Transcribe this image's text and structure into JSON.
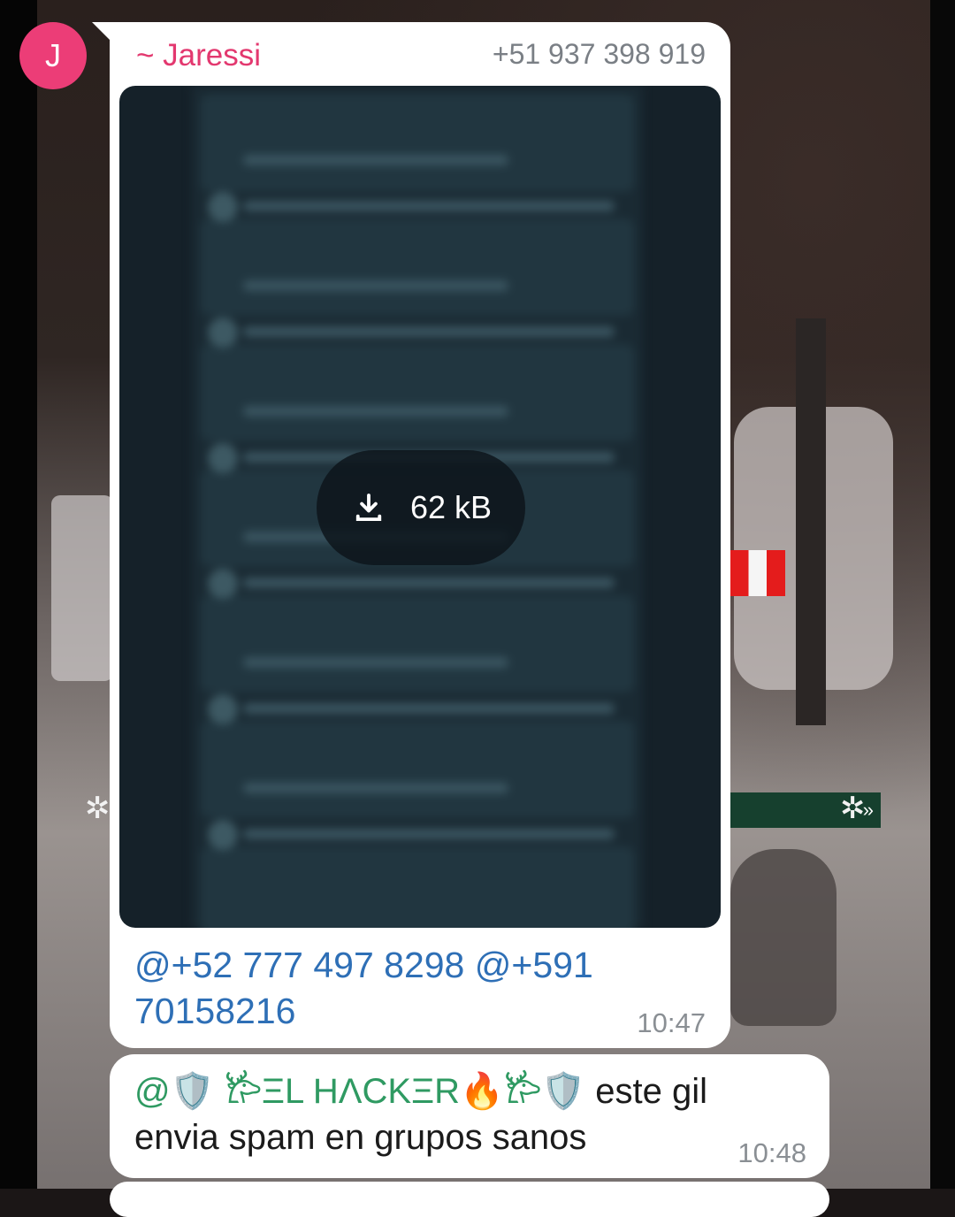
{
  "message_1": {
    "avatar_letter": "J",
    "sender_name": "~ Jaressi",
    "sender_phone": "+51 937 398 919",
    "media": {
      "download_icon": "download-icon",
      "size_label": "62 kB"
    },
    "mentions": [
      "@+52 777 497 8298",
      "@+591 70158216"
    ],
    "time": "10:47"
  },
  "message_2": {
    "mention_text": "@🛡️ 𐂂ΞL ΗΛCKΞR🔥𐂂🛡️",
    "body_text": "este gil envia spam en grupos sanos",
    "time": "10:48"
  },
  "colors": {
    "sender_name": "#e3386f",
    "mention": "#2e6fb6",
    "avatar": "#ec3d77"
  }
}
